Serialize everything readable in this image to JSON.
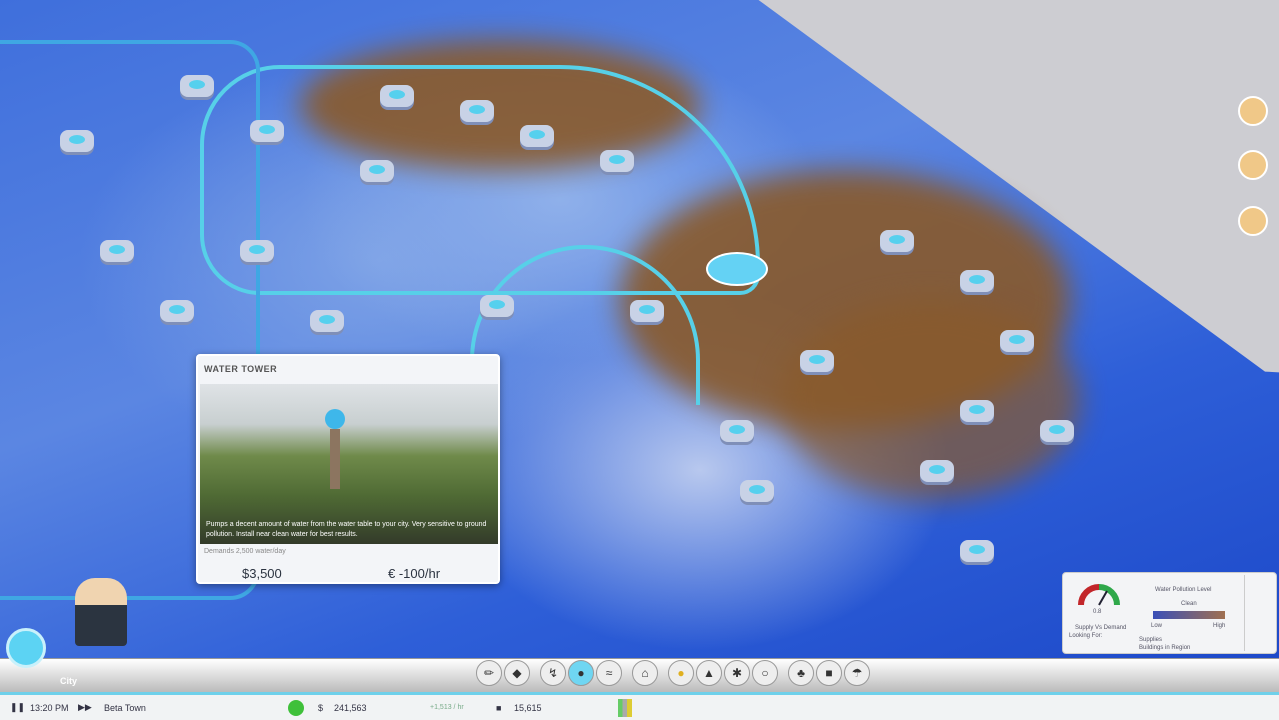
{
  "panel": {
    "title": "WATER TOWER",
    "description": "Pumps a decent amount of water from the water table to your city. Very sensitive to ground pollution. Install near clean water for best results.",
    "footer": "Demands 2,500 water/day",
    "cost": "$3,500",
    "upkeep": "-100/hr"
  },
  "overlay": {
    "gauge_value": "0.8",
    "gauge_label": "Supply Vs Demand",
    "legend_title": "Water Pollution Level",
    "legend_sub": "Clean",
    "low": "Low",
    "high": "High",
    "looking_for": "Looking For:",
    "mode": "Supplies",
    "mode_sub": "Buildings in Region"
  },
  "hud": {
    "city_tab": "City",
    "time": "13:20 PM",
    "city_name": "Beta Town",
    "money": "241,563",
    "rate": "+1,513 / hr",
    "population": "15,615"
  },
  "toolbar": [
    "road-tool",
    "zone-tool",
    "power-tool",
    "water-tool",
    "sewage-tool",
    "government-tool",
    "residential-tool",
    "education-tool",
    "health-tool",
    "police-tool",
    "park-tool",
    "transport-tool",
    "mass-transit-tool"
  ],
  "colors": {
    "water": "#57d0e8",
    "pollution": "#8a5a2a",
    "map": "#3f6fdc"
  }
}
